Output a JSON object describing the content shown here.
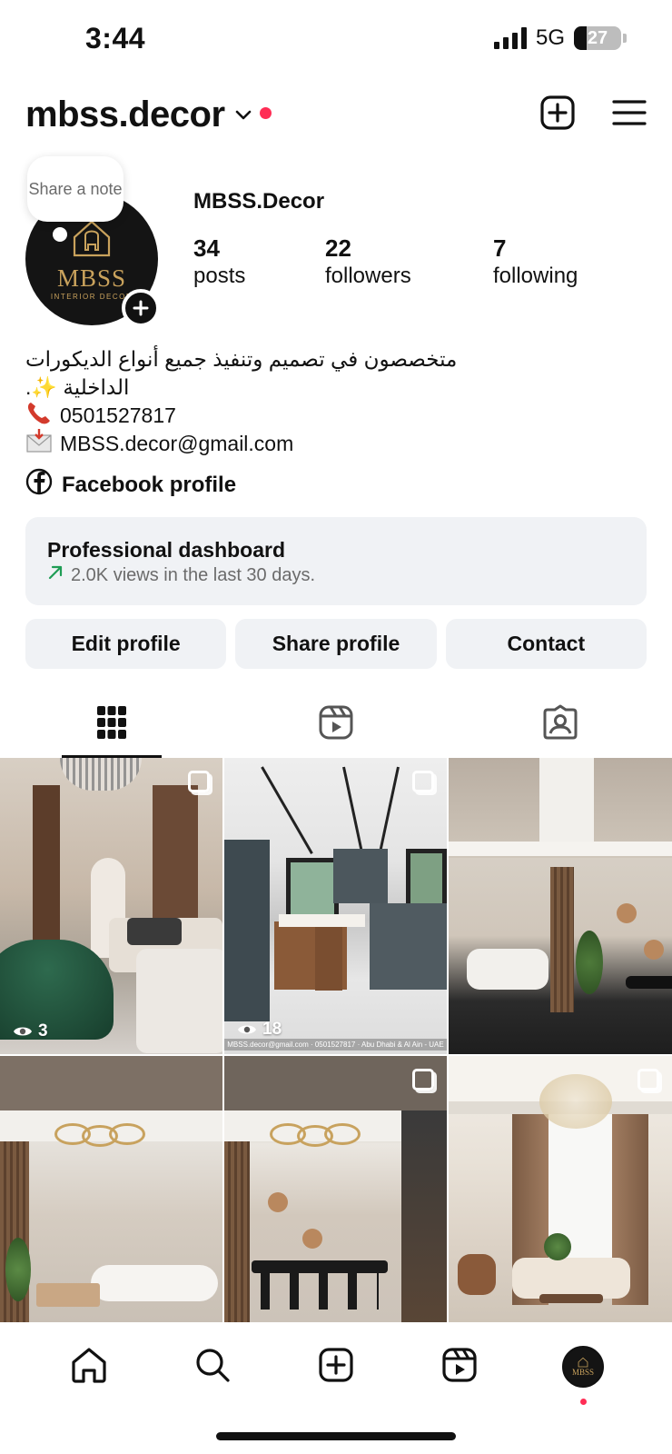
{
  "status_bar": {
    "time": "3:44",
    "network": "5G",
    "battery": "27",
    "battery_fraction": 0.27
  },
  "header": {
    "username": "mbss.decor",
    "icons": [
      "chevron-down-icon",
      "new-post-icon",
      "menu-icon"
    ],
    "notification_color": "#ff2d55"
  },
  "profile": {
    "note_prompt": "Share a note",
    "avatar_text": "MBSS",
    "avatar_subtext": "INTERIOR DECOR",
    "display_name": "MBSS.Decor",
    "stats": [
      {
        "count": "34",
        "label": "posts"
      },
      {
        "count": "22",
        "label": "followers"
      },
      {
        "count": "7",
        "label": "following"
      }
    ],
    "bio": {
      "line1": "متخصصون في تصميم وتنفيذ جميع أنواع الديكورات",
      "line2": "الداخلية ✨.",
      "phone": "0501527817",
      "email": "MBSS.decor@gmail.com"
    },
    "facebook_link": "Facebook profile"
  },
  "dashboard": {
    "title": "Professional dashboard",
    "subtitle": "2.0K views in the last 30 days."
  },
  "buttons": {
    "edit": "Edit profile",
    "share": "Share profile",
    "contact": "Contact"
  },
  "tabs": [
    {
      "icon": "grid-icon",
      "active": true
    },
    {
      "icon": "reels-icon",
      "active": false
    },
    {
      "icon": "tagged-icon",
      "active": false
    }
  ],
  "grid": {
    "posts": [
      {
        "type": "carousel",
        "views": "3"
      },
      {
        "type": "carousel",
        "views": "18",
        "caption": "MBSS.decor@gmail.com · 0501527817 · Abu Dhabi & Al Ain - UAE"
      },
      {
        "type": "image"
      },
      {
        "type": "image"
      },
      {
        "type": "carousel"
      },
      {
        "type": "carousel"
      }
    ]
  },
  "bottom_nav": {
    "items": [
      "home-icon",
      "search-icon",
      "create-icon",
      "reels-icon",
      "profile-avatar"
    ],
    "avatar_text": "MBSS"
  }
}
